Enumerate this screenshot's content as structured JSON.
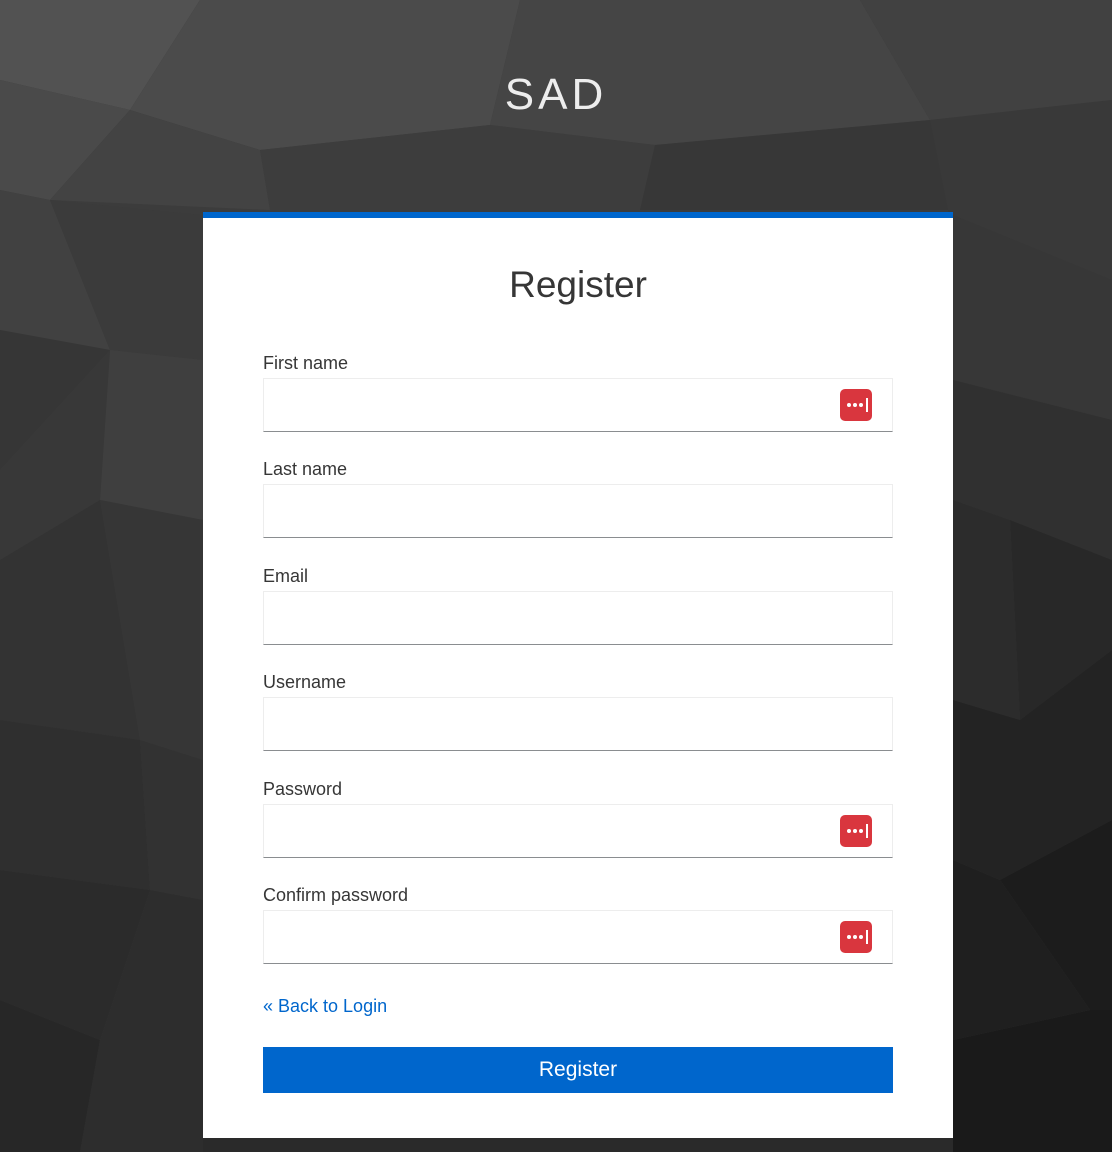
{
  "realm": {
    "title": "SAD"
  },
  "form": {
    "title": "Register",
    "fields": [
      {
        "label": "First name",
        "value": "",
        "password_manager_icon": true
      },
      {
        "label": "Last name",
        "value": "",
        "password_manager_icon": false
      },
      {
        "label": "Email",
        "value": "",
        "password_manager_icon": false
      },
      {
        "label": "Username",
        "value": "",
        "password_manager_icon": false
      },
      {
        "label": "Password",
        "value": "",
        "password_manager_icon": true
      },
      {
        "label": "Confirm password",
        "value": "",
        "password_manager_icon": true
      }
    ],
    "back_link": "« Back to Login",
    "submit_label": "Register"
  },
  "icons": {
    "password_manager": "password-manager-icon"
  },
  "colors": {
    "accent": "#0066cc",
    "card_background": "#ffffff",
    "page_background": "#3a3a3a",
    "password_manager_icon": "#d9363e",
    "link": "#0066cc"
  }
}
